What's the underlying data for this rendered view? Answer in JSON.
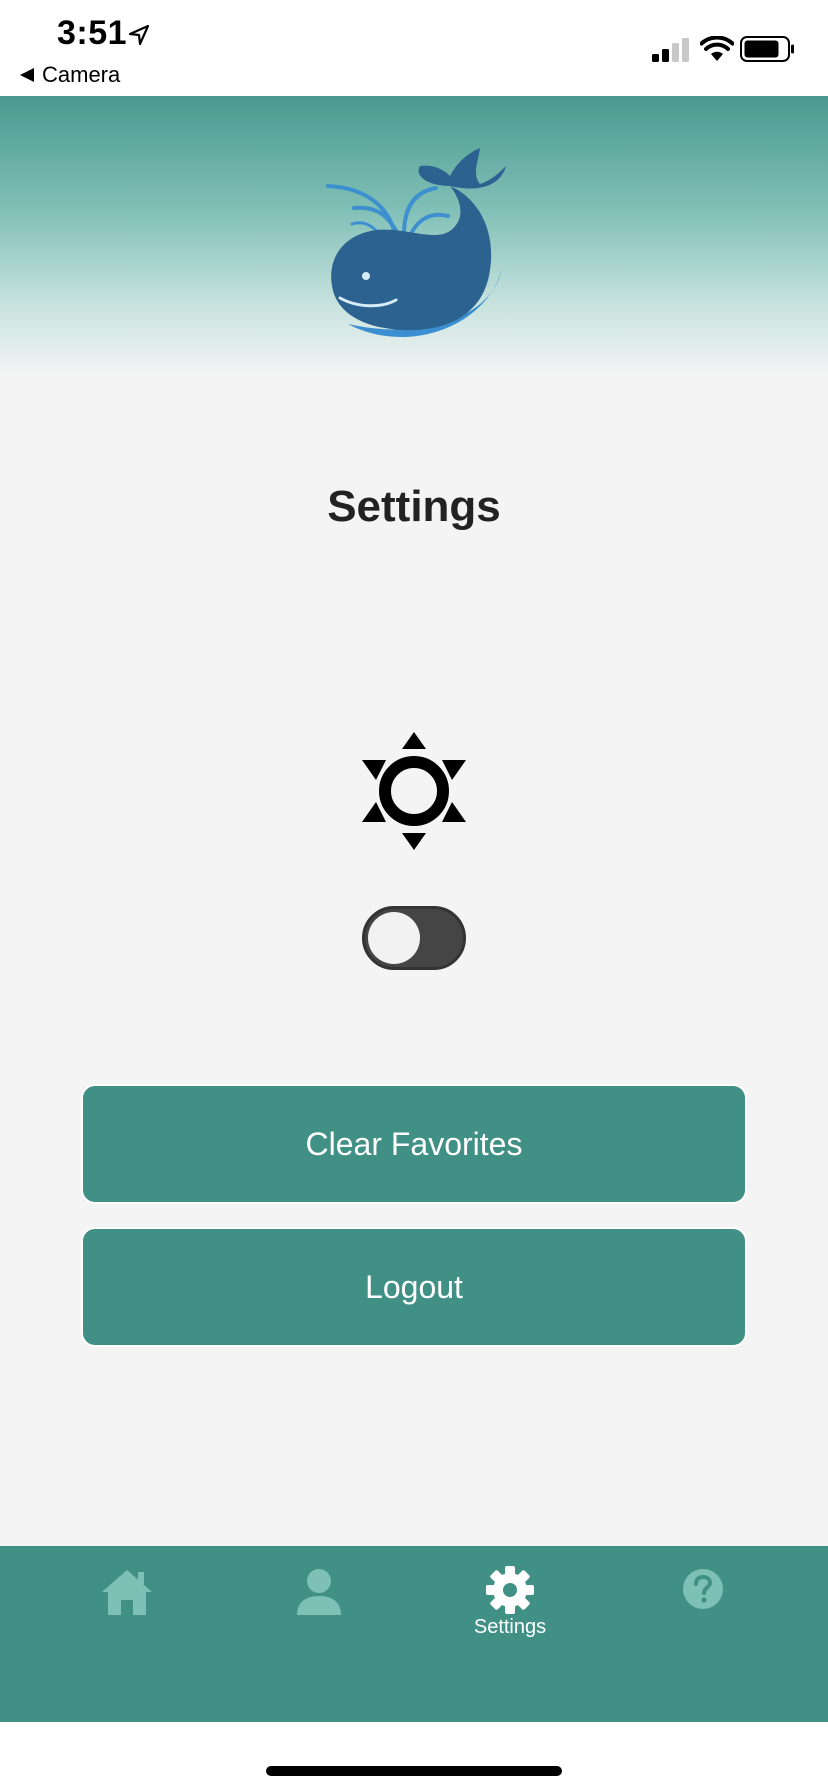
{
  "status_bar": {
    "time": "3:51",
    "back_label": "Camera"
  },
  "page": {
    "title": "Settings"
  },
  "theme_toggle": {
    "on": false
  },
  "buttons": {
    "clear_favorites": "Clear Favorites",
    "logout": "Logout"
  },
  "tab_bar": {
    "active": "settings",
    "settings_label": "Settings"
  },
  "colors": {
    "accent": "#419085",
    "inactive_tab_icon": "#7cc0b6",
    "whale": "#2b6290",
    "wave": "#3b8fd0"
  }
}
